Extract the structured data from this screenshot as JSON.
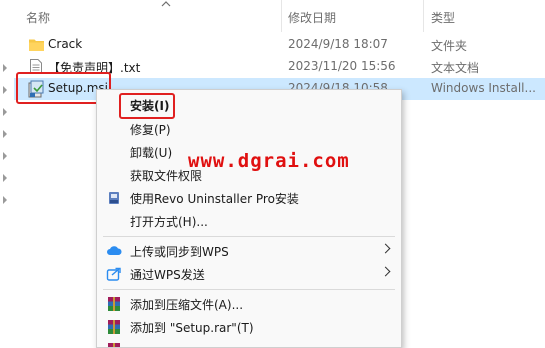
{
  "columns": {
    "name": "名称",
    "date": "修改日期",
    "type": "类型"
  },
  "files": [
    {
      "name": "Crack",
      "date": "2024/9/18 18:07",
      "type": "文件夹",
      "icon": "folder-icon"
    },
    {
      "name": "【免责声明】.txt",
      "date": "2023/11/20 15:56",
      "type": "文本文档",
      "icon": "text-file-icon"
    },
    {
      "name": "Setup.msi",
      "date": "2024/9/18 10:58",
      "type": "Windows Install...",
      "icon": "msi-installer-icon"
    }
  ],
  "context_menu": {
    "install": "安装(I)",
    "repair": "修复(P)",
    "uninstall": "卸载(U)",
    "take_ownership": "获取文件权限",
    "revo": "使用Revo Uninstaller Pro安装",
    "open_with": "打开方式(H)...",
    "upload_wps": "上传或同步到WPS",
    "send_wps": "通过WPS发送",
    "add_archive": "添加到压缩文件(A)...",
    "add_rar": "添加到 \"Setup.rar\"(T)"
  },
  "watermark": "www.dgrai.com",
  "colors": {
    "selection": "#cce8ff",
    "highlight_box": "#e02020",
    "watermark": "#e01010"
  }
}
